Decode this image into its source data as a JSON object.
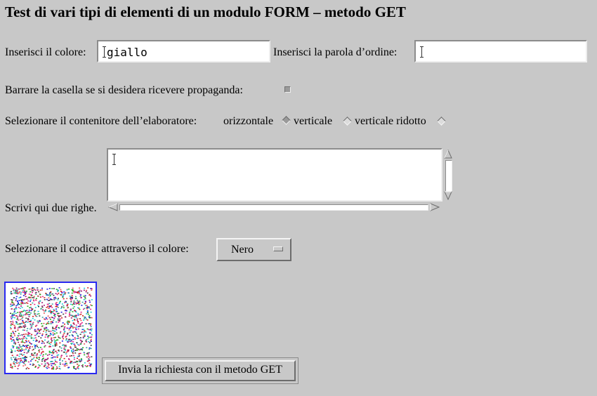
{
  "page": {
    "title": "Test di vari tipi di elementi di un modulo FORM – metodo GET"
  },
  "colore": {
    "label": "Inserisci il colore:",
    "value": "giallo"
  },
  "parola_ordine": {
    "label": "Inserisci la parola d’ordine:",
    "value": ""
  },
  "propaganda": {
    "label": "Barrare la casella se si desidera ricevere propaganda:",
    "checked": false
  },
  "contenitore": {
    "label": "Selezionare il contenitore dell’elaboratore:",
    "options": [
      {
        "label": "orizzontale",
        "selected": true
      },
      {
        "label": "verticale",
        "selected": false
      },
      {
        "label": "verticale ridotto",
        "selected": false
      }
    ]
  },
  "righe": {
    "label": "Scrivi qui due righe.",
    "value": ""
  },
  "codice": {
    "label": "Selezionare il codice attraverso il colore:",
    "selected": "Nero"
  },
  "submit": {
    "label": "Invia la richiesta con il metodo GET"
  },
  "colors": {
    "background": "#c8c8c8",
    "image_border": "#2a2af0"
  }
}
